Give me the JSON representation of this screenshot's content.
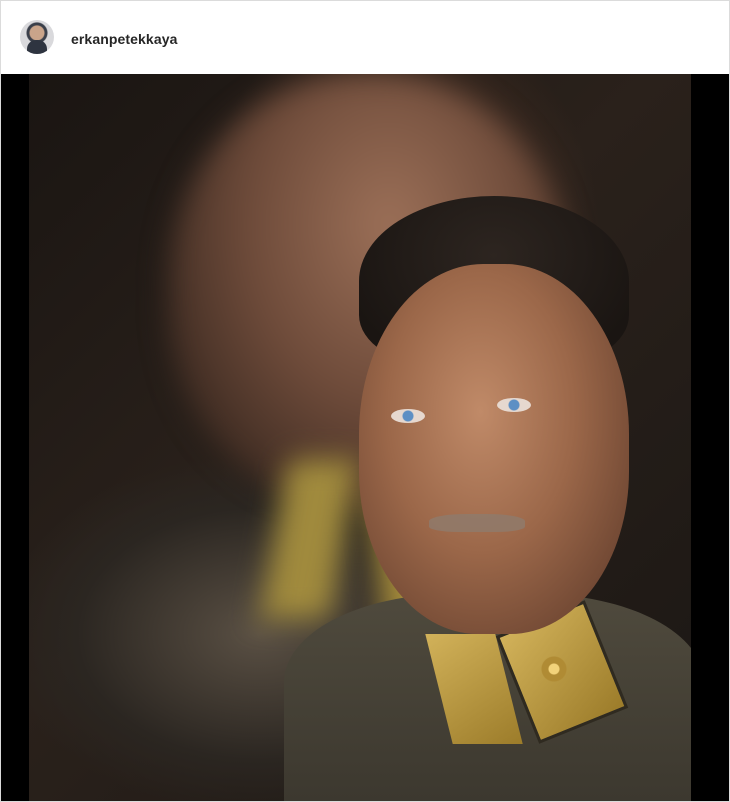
{
  "post": {
    "author": {
      "username": "erkanpetekkaya",
      "avatar_icon": "profile-avatar"
    },
    "image": {
      "alt": "",
      "background_color": "#000000"
    }
  },
  "colors": {
    "username_text": "#262626",
    "border": "#dbdbdb",
    "background": "#ffffff"
  }
}
